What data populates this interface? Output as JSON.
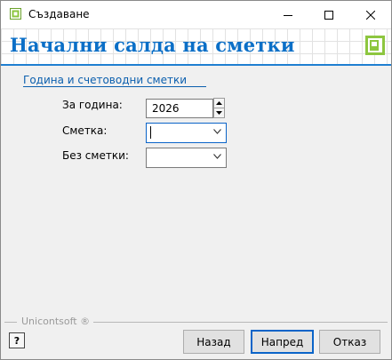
{
  "window": {
    "title": "Създаване"
  },
  "banner": {
    "title": "Начални салда на сметки"
  },
  "section": {
    "title": "Година и счетоводни сметки"
  },
  "form": {
    "year_label": "За година:",
    "year_value": "2026",
    "account_label": "Сметка:",
    "account_value": "",
    "without_accounts_label": "Без сметки:",
    "without_accounts_value": ""
  },
  "footer": {
    "brand": "Unicontsoft ®",
    "help_label": "?",
    "back_label": "Назад",
    "next_label": "Напред",
    "cancel_label": "Отказ"
  },
  "icons": {
    "app": "app-icon",
    "minimize": "minimize-icon",
    "maximize": "maximize-icon",
    "close": "close-icon",
    "logo": "unicontsoft-logo-icon",
    "spin_up": "chevron-up-icon",
    "spin_down": "chevron-down-icon",
    "dropdown": "chevron-down-icon"
  },
  "colors": {
    "accent": "#0b6fc7",
    "section": "#0b5fae",
    "logo": "#8dc63f",
    "focus": "#0a64c8"
  }
}
